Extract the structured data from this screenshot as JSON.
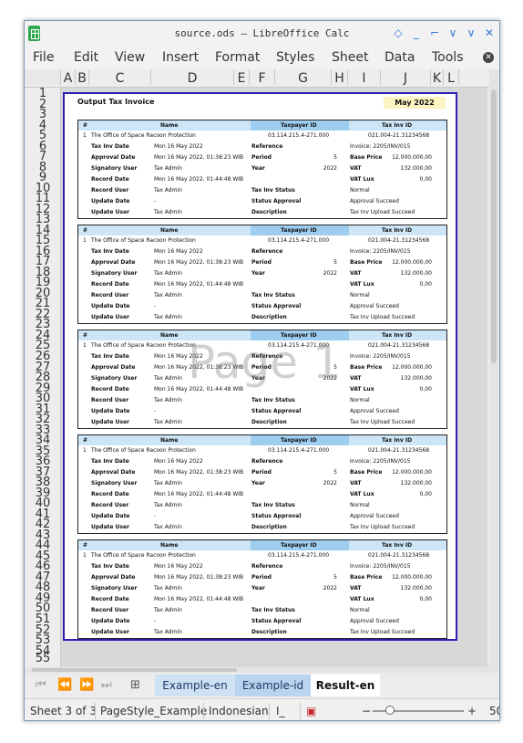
{
  "window": {
    "title": "source.ods – LibreOffice Calc"
  },
  "menu": [
    "File",
    "Edit",
    "View",
    "Insert",
    "Format",
    "Styles",
    "Sheet",
    "Data",
    "Tools"
  ],
  "columns": [
    "A",
    "B",
    "C",
    "D",
    "E",
    "F",
    "G",
    "H",
    "I",
    "J",
    "K",
    "L"
  ],
  "rows": [
    "1",
    "2",
    "3",
    "4",
    "5",
    "6",
    "7",
    "8",
    "9",
    "10",
    "11",
    "12",
    "13",
    "14",
    "15",
    "16",
    "17",
    "18",
    "19",
    "20",
    "21",
    "22",
    "23",
    "24",
    "25",
    "26",
    "27",
    "28",
    "29",
    "30",
    "31",
    "32",
    "33",
    "34",
    "35",
    "36",
    "37",
    "38",
    "39",
    "40",
    "41",
    "42",
    "43",
    "44",
    "45",
    "46",
    "47",
    "48",
    "49",
    "50",
    "51",
    "52",
    "53",
    "54",
    "55"
  ],
  "report": {
    "title": "Output Tax Invoice",
    "month": "May 2022",
    "watermark": "Page 1"
  },
  "headers": {
    "no": "#",
    "name": "Name",
    "taxpayer_id": "Taxpayer ID",
    "tax_inv_id": "Tax Inv ID"
  },
  "invoice": {
    "no": "1",
    "name": "The Office of Space Racoon Protection",
    "taxpayer_id": "03.114.215.4-271.000",
    "tax_inv_id": "021.004-21.31234568",
    "labels": {
      "tax_inv_date": "Tax Inv Date",
      "approval_date": "Approval Date",
      "signatory_user": "Signatory User",
      "record_date": "Record Date",
      "record_user": "Record User",
      "update_date": "Update Date",
      "update_user": "Update User",
      "reference": "Reference",
      "period": "Period",
      "year": "Year",
      "tax_inv_status": "Tax Inv Status",
      "status_approval": "Status Approval",
      "description": "Description",
      "invoice": "Invoice: 2205/INV/015",
      "base_price": "Base Price",
      "vat": "VAT",
      "vat_lux": "VAT Lux"
    },
    "values": {
      "tax_inv_date": "Mon 16 May 2022",
      "approval_date": "Mon 16 May 2022, 01:38:23 WIB",
      "signatory_user": "Tax Admin",
      "record_date": "Mon 16 May 2022, 01:44:48 WIB",
      "record_user": "Tax Admin",
      "update_date": "-",
      "update_user": "Tax Admin",
      "period": "5",
      "year": "2022",
      "base_price": "12.000.000,00",
      "vat": "132.000,00",
      "vat_lux": "0,00",
      "status": "Normal",
      "approval": "Approval Succeed",
      "description": "Tax Inv Upload Succeed"
    }
  },
  "tabs": {
    "nav": [
      "⏮",
      "⏪",
      "⏩",
      "⏭"
    ],
    "items": [
      "Example-en",
      "Example-id",
      "Result-en"
    ]
  },
  "status": {
    "sheet": "Sheet 3 of 3",
    "page_style": "PageStyle_Example",
    "language": "Indonesian",
    "zoom": "50"
  }
}
